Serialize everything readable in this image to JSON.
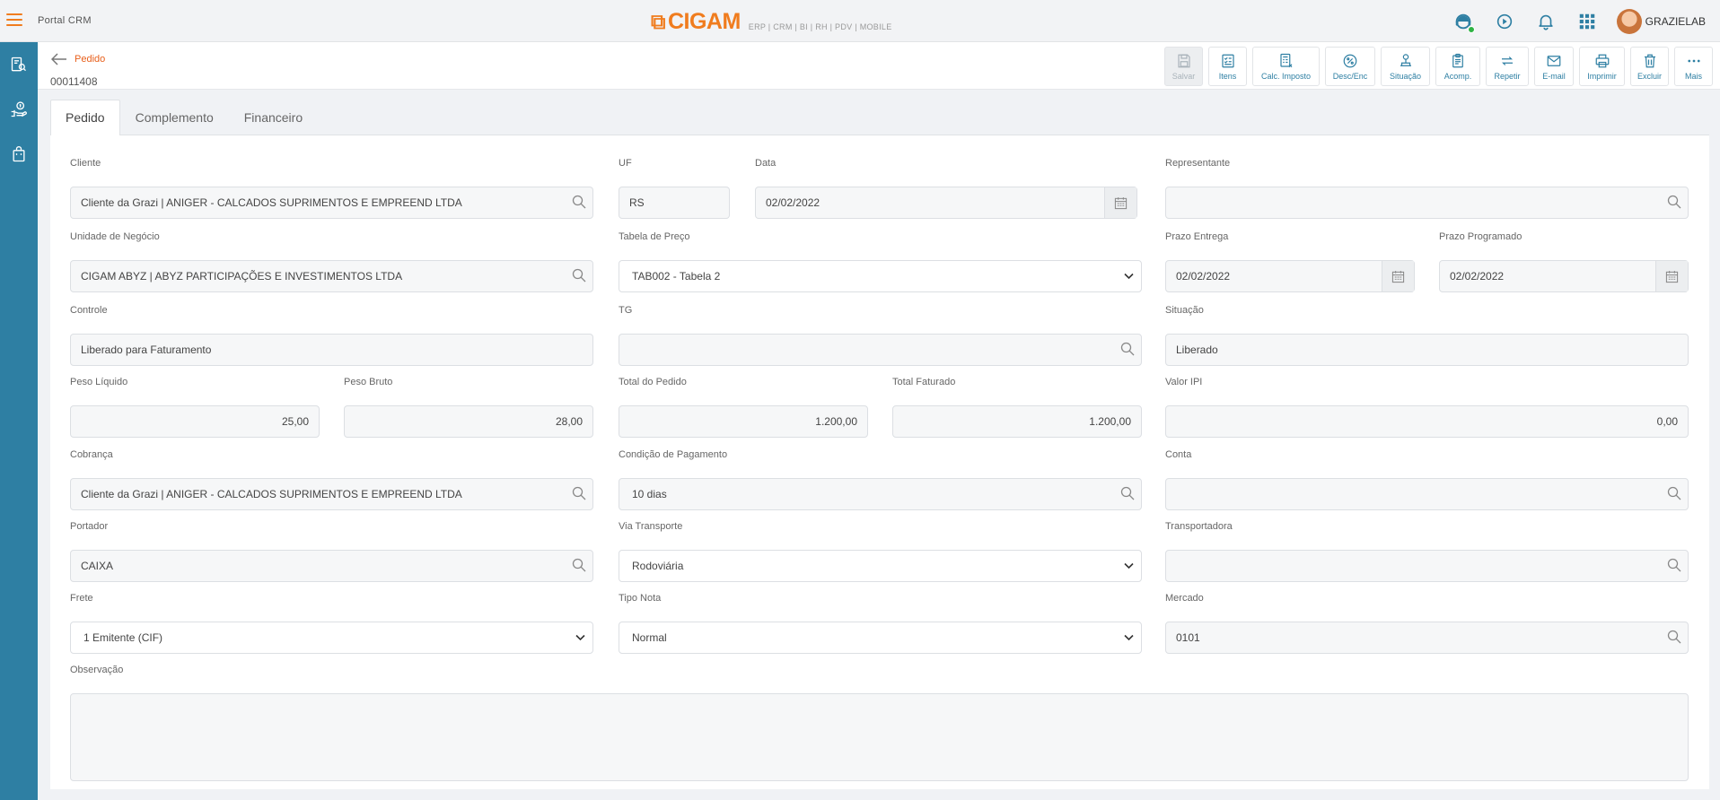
{
  "topbar": {
    "app_title": "Portal CRM",
    "brand": "CIGAM",
    "brand_tagline": "ERP | CRM | BI | RH | PDV | MOBILE",
    "username": "GRAZIELAB"
  },
  "header": {
    "back_label": "Pedido",
    "order_number": "00011408"
  },
  "toolbar": [
    {
      "label": "Salvar",
      "icon": "save-icon",
      "disabled": true
    },
    {
      "label": "Itens",
      "icon": "checklist-icon"
    },
    {
      "label": "Calc. Imposto",
      "icon": "calculator-icon"
    },
    {
      "label": "Desc/Enc",
      "icon": "percent-icon"
    },
    {
      "label": "Situação",
      "icon": "workflow-icon"
    },
    {
      "label": "Acomp.",
      "icon": "clipboard-icon"
    },
    {
      "label": "Repetir",
      "icon": "repeat-icon"
    },
    {
      "label": "E-mail",
      "icon": "mail-icon"
    },
    {
      "label": "Imprimir",
      "icon": "printer-icon"
    },
    {
      "label": "Excluir",
      "icon": "trash-icon"
    },
    {
      "label": "Mais",
      "icon": "more-icon"
    }
  ],
  "tabs": [
    "Pedido",
    "Complemento",
    "Financeiro"
  ],
  "form": {
    "cliente": {
      "label": "Cliente",
      "value": "Cliente da Grazi | ANIGER - CALCADOS SUPRIMENTOS E EMPREEND LTDA"
    },
    "uf": {
      "label": "UF",
      "value": "RS"
    },
    "data": {
      "label": "Data",
      "value": "02/02/2022"
    },
    "representante": {
      "label": "Representante",
      "value": ""
    },
    "unidade": {
      "label": "Unidade de Negócio",
      "value": "CIGAM ABYZ | ABYZ PARTICIPAÇÕES E INVESTIMENTOS LTDA"
    },
    "tabela_preco": {
      "label": "Tabela de Preço",
      "value": "TAB002 - Tabela 2"
    },
    "prazo_entrega": {
      "label": "Prazo Entrega",
      "value": "02/02/2022"
    },
    "prazo_programado": {
      "label": "Prazo Programado",
      "value": "02/02/2022"
    },
    "controle": {
      "label": "Controle",
      "value": "Liberado para Faturamento"
    },
    "tg": {
      "label": "TG",
      "value": ""
    },
    "situacao": {
      "label": "Situação",
      "value": "Liberado"
    },
    "peso_liquido": {
      "label": "Peso Líquido",
      "value": "25,00"
    },
    "peso_bruto": {
      "label": "Peso Bruto",
      "value": "28,00"
    },
    "total_pedido": {
      "label": "Total do Pedido",
      "value": "1.200,00"
    },
    "total_faturado": {
      "label": "Total Faturado",
      "value": "1.200,00"
    },
    "valor_ipi": {
      "label": "Valor IPI",
      "value": "0,00"
    },
    "cobranca": {
      "label": "Cobrança",
      "value": "Cliente da Grazi | ANIGER - CALCADOS SUPRIMENTOS E EMPREEND LTDA"
    },
    "condicao_pagamento": {
      "label": "Condição de Pagamento",
      "value": "10 dias"
    },
    "conta": {
      "label": "Conta",
      "value": ""
    },
    "portador": {
      "label": "Portador",
      "value": "CAIXA"
    },
    "via_transporte": {
      "label": "Via Transporte",
      "value": "Rodoviária"
    },
    "transportadora": {
      "label": "Transportadora",
      "value": ""
    },
    "frete": {
      "label": "Frete",
      "value": "1 Emitente (CIF)"
    },
    "tipo_nota": {
      "label": "Tipo Nota",
      "value": "Normal"
    },
    "mercado": {
      "label": "Mercado",
      "value": "0101"
    },
    "observacao": {
      "label": "Observação",
      "value": ""
    }
  },
  "colors": {
    "accent_orange": "#f07c1e",
    "sidebar_blue": "#2e7fa3",
    "icon_blue": "#2e7fa3"
  }
}
